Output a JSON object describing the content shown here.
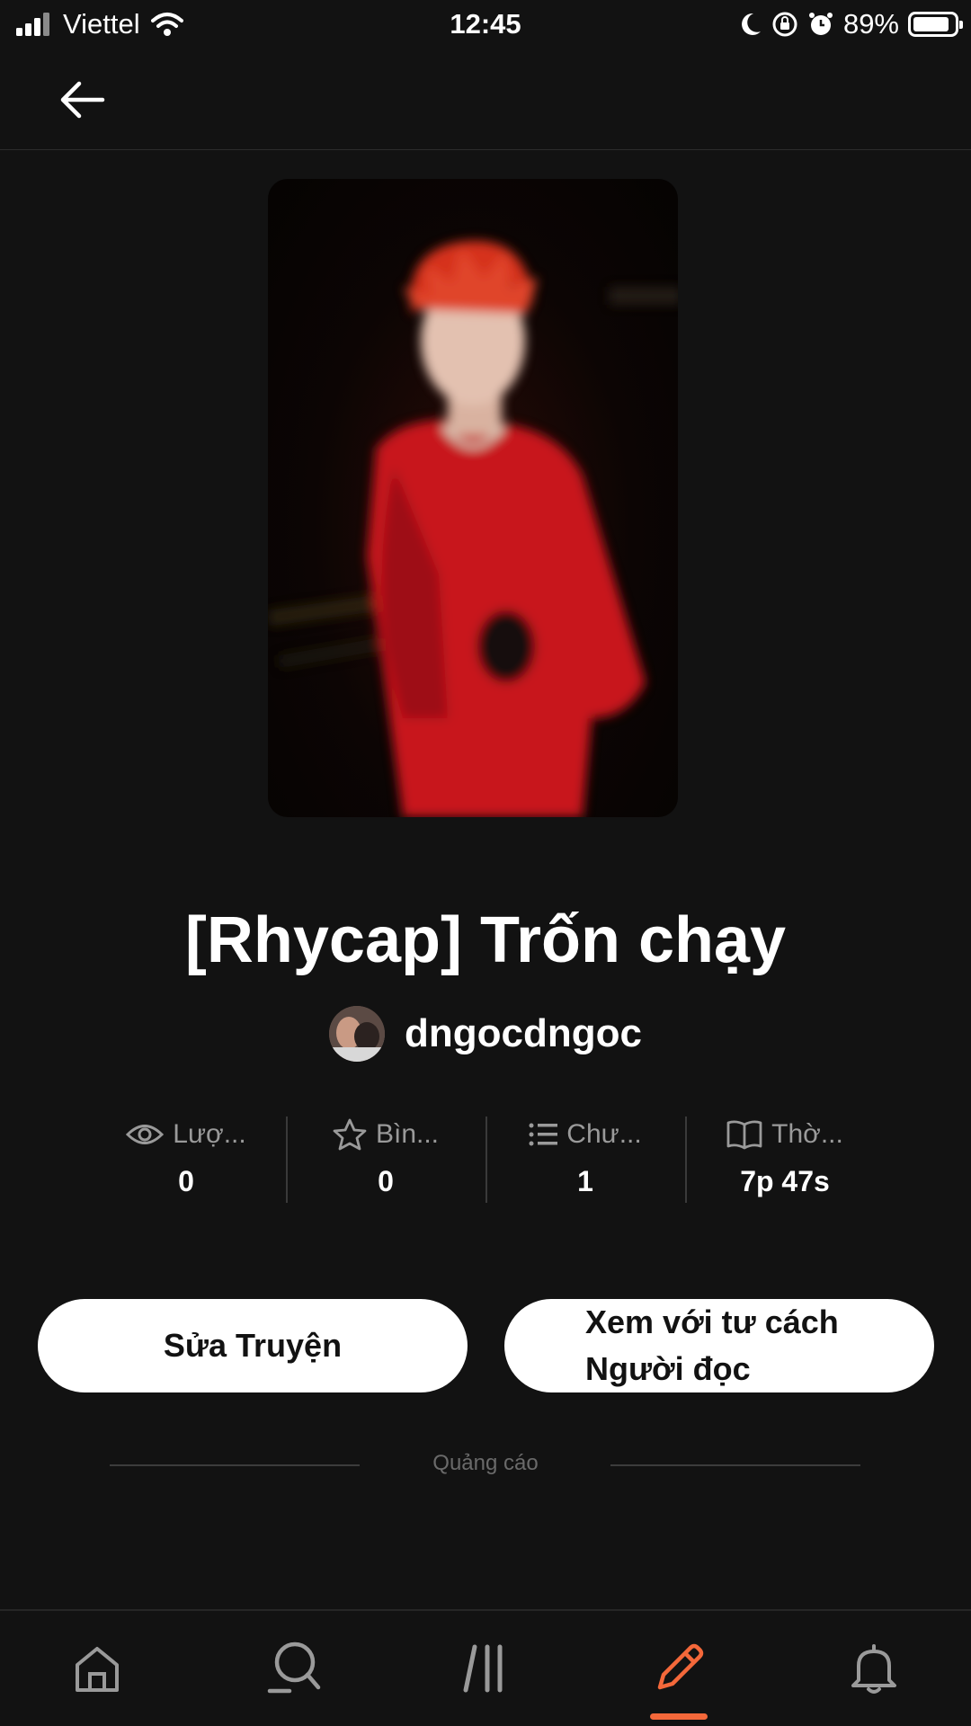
{
  "status_bar": {
    "carrier": "Viettel",
    "time": "12:45",
    "battery": "89%",
    "battery_level": 0.89,
    "icons": [
      "signal-icon",
      "wifi-icon",
      "moon-icon",
      "orientation-lock-icon",
      "alarm-icon",
      "battery-icon"
    ]
  },
  "nav": {
    "back_icon": "arrow-left-icon"
  },
  "story": {
    "title": "[Rhycap] Trốn chạy",
    "author": "dngocdngoc"
  },
  "stats": [
    {
      "icon": "eye-icon",
      "label": "Lượ...",
      "value": "0"
    },
    {
      "icon": "star-icon",
      "label": "Bìn...",
      "value": "0"
    },
    {
      "icon": "list-icon",
      "label": "Chư...",
      "value": "1"
    },
    {
      "icon": "book-icon",
      "label": "Thờ...",
      "value": "7p 47s"
    }
  ],
  "buttons": {
    "edit": "Sửa Truyện",
    "read_as_reader": "Xem với tư cách Người đọc"
  },
  "ad": {
    "label": "Quảng cáo"
  },
  "tab_bar": {
    "items": [
      "home-icon",
      "search-icon",
      "library-icon",
      "write-icon",
      "notifications-icon"
    ],
    "active": "write-icon",
    "accent_color": "#f4683a"
  }
}
